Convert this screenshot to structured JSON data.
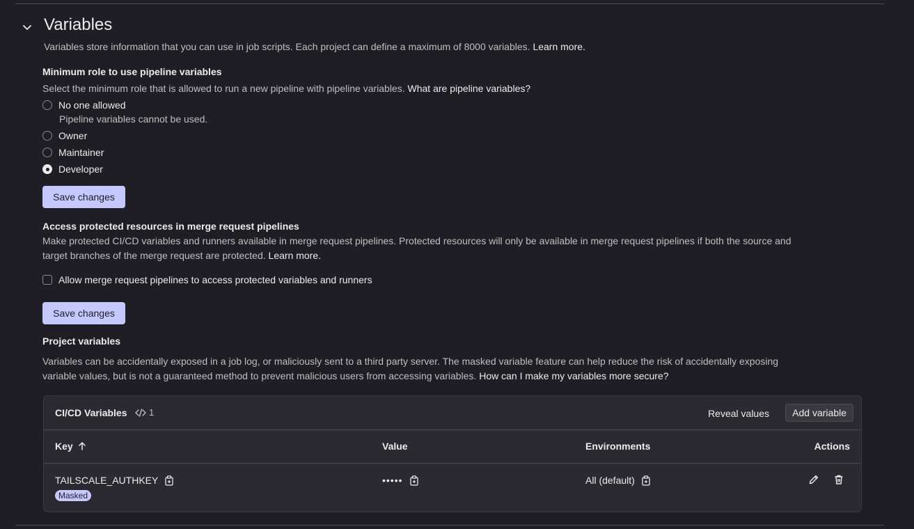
{
  "section": {
    "title": "Variables",
    "description": "Variables store information that you can use in job scripts. Each project can define a maximum of 8000 variables.",
    "learn_more": "Learn more."
  },
  "min_role": {
    "heading": "Minimum role to use pipeline variables",
    "description": "Select the minimum role that is allowed to run a new pipeline with pipeline variables.",
    "link": "What are pipeline variables?",
    "options": [
      {
        "label": "No one allowed",
        "help": "Pipeline variables cannot be used.",
        "selected": false
      },
      {
        "label": "Owner",
        "selected": false
      },
      {
        "label": "Maintainer",
        "selected": false
      },
      {
        "label": "Developer",
        "selected": true
      }
    ],
    "save_label": "Save changes"
  },
  "protected": {
    "heading": "Access protected resources in merge request pipelines",
    "description_line1": "Make protected CI/CD variables and runners available in merge request pipelines. Protected resources will only be available in merge request pipelines if both the source and",
    "description_line2": "target branches of the merge request are protected.",
    "learn_more": "Learn more.",
    "checkbox_label": "Allow merge request pipelines to access protected variables and runners",
    "checked": false,
    "save_label": "Save changes"
  },
  "project_vars": {
    "heading": "Project variables",
    "line1": "Variables can be accidentally exposed in a job log, or maliciously sent to a third party server. The masked variable feature can help reduce the risk of accidentally exposing",
    "line2": "variable values, but is not a guaranteed method to prevent malicious users from accessing variables.",
    "link": "How can I make my variables more secure?"
  },
  "table": {
    "title": "CI/CD Variables",
    "count": "1",
    "reveal_label": "Reveal values",
    "add_label": "Add variable",
    "columns": {
      "key": "Key",
      "value": "Value",
      "environments": "Environments",
      "actions": "Actions"
    },
    "rows": [
      {
        "key": "TAILSCALE_AUTHKEY",
        "badge": "Masked",
        "value": "•••••",
        "environment": "All (default)"
      }
    ]
  },
  "colors": {
    "background": "#1f1e24",
    "card": "#2b2a30",
    "primary_button": "#c5c7ff",
    "text": "#ececef",
    "muted": "#bfbfc3"
  },
  "icons": [
    "chevron-down-icon",
    "code-icon",
    "arrow-up-icon",
    "copy-icon",
    "pencil-icon",
    "trash-icon"
  ]
}
